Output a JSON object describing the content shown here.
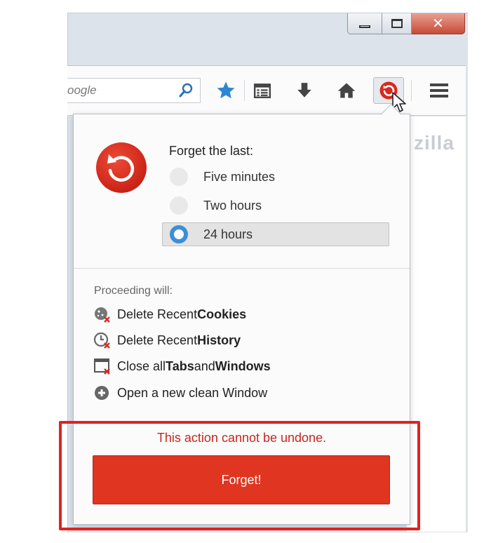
{
  "search": {
    "value": "oogle"
  },
  "toolbar": {
    "icons": [
      "search-icon",
      "star-icon",
      "reading-list-icon",
      "download-icon",
      "home-icon",
      "forget-icon",
      "menu-icon"
    ],
    "page_watermark": "zilla"
  },
  "panel": {
    "options_title": "Forget the last:",
    "options": [
      {
        "label": "Five minutes",
        "selected": false
      },
      {
        "label": "Two hours",
        "selected": false
      },
      {
        "label": "24 hours",
        "selected": true
      }
    ],
    "proceed_title": "Proceeding will:",
    "actions": [
      {
        "prefix": "Delete Recent ",
        "bold": "Cookies",
        "icon": "cookie-delete-icon"
      },
      {
        "prefix": "Delete Recent ",
        "bold": "History",
        "icon": "history-delete-icon"
      },
      {
        "prefix": "Close all ",
        "bold": "Tabs",
        "middle": " and ",
        "bold2": "Windows",
        "icon": "window-close-icon"
      },
      {
        "prefix": "Open a new clean Window",
        "icon": "plus-circle-icon"
      }
    ],
    "warning": "This action cannot be undone.",
    "forget_label": "Forget!"
  },
  "colors": {
    "accent_red": "#df3521",
    "warning_red": "#c4281f",
    "radio_blue": "#3b8fd6",
    "star_blue": "#2b87d4"
  }
}
